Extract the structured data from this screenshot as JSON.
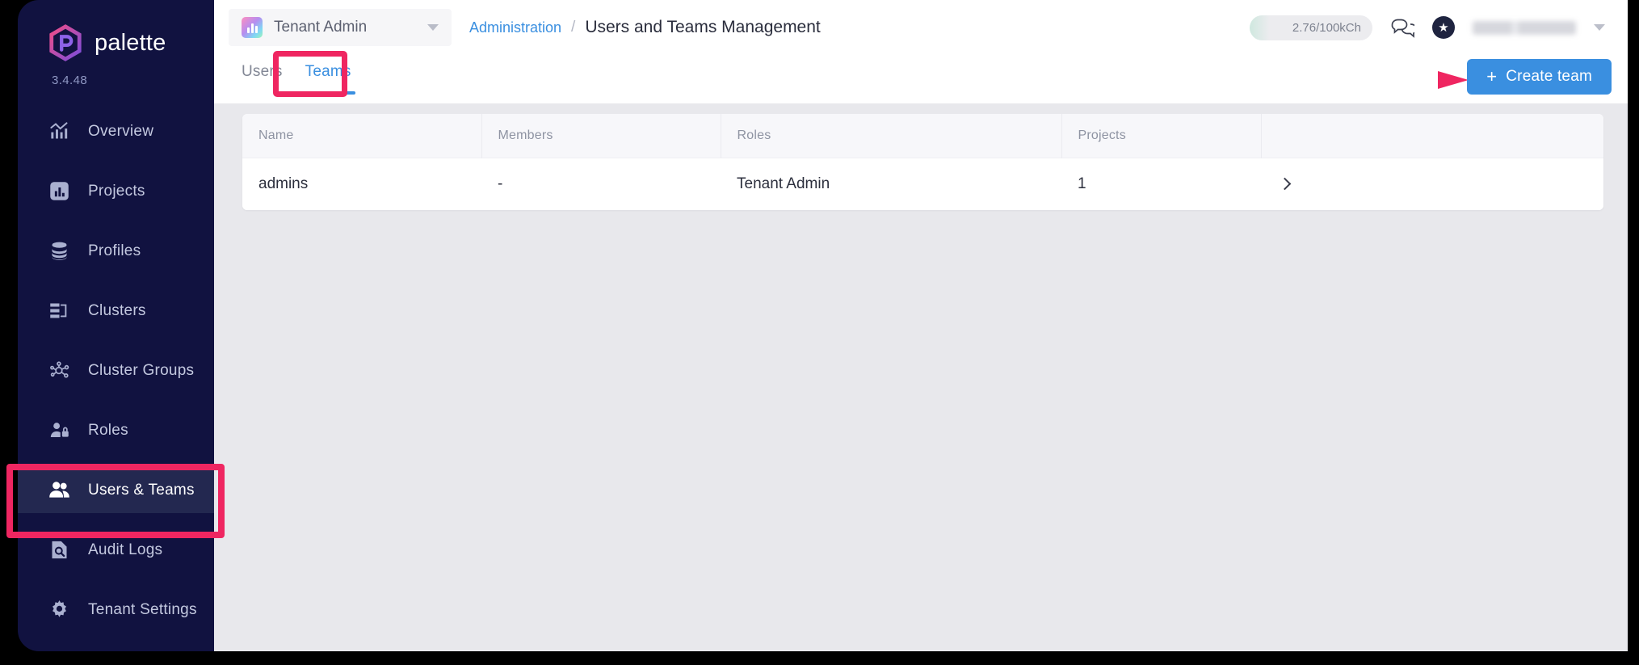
{
  "sidebar": {
    "brand": "palette",
    "version": "3.4.48",
    "items": [
      {
        "label": "Overview",
        "icon": "chart-overview-icon",
        "active": false
      },
      {
        "label": "Projects",
        "icon": "projects-icon",
        "active": false
      },
      {
        "label": "Profiles",
        "icon": "profiles-stack-icon",
        "active": false
      },
      {
        "label": "Clusters",
        "icon": "clusters-icon",
        "active": false
      },
      {
        "label": "Cluster Groups",
        "icon": "cluster-groups-icon",
        "active": false
      },
      {
        "label": "Roles",
        "icon": "roles-user-lock-icon",
        "active": false
      },
      {
        "label": "Users & Teams",
        "icon": "users-teams-icon",
        "active": true
      },
      {
        "label": "Audit Logs",
        "icon": "audit-logs-icon",
        "active": false
      },
      {
        "label": "Tenant Settings",
        "icon": "gear-icon",
        "active": false
      }
    ]
  },
  "topbar": {
    "tenant_selector": "Tenant Admin",
    "breadcrumb": {
      "parent": "Administration",
      "separator": "/",
      "current": "Users and Teams Management"
    },
    "usage": "2.76/100kCh",
    "chat_icon": "chat-bubbles-icon",
    "star_icon": "star-badge-icon",
    "user_caret_icon": "chevron-down-icon"
  },
  "tabs": [
    {
      "label": "Users",
      "active": false
    },
    {
      "label": "Teams",
      "active": true
    }
  ],
  "toolbar": {
    "create_team_label": "Create team",
    "plus": "+"
  },
  "table": {
    "columns": [
      "Name",
      "Members",
      "Roles",
      "Projects",
      ""
    ],
    "rows": [
      {
        "name": "admins",
        "members": "-",
        "roles": "Tenant Admin",
        "projects": "1"
      }
    ]
  },
  "annotations": {
    "nav_highlight_target": "Users & Teams",
    "tab_highlight_target": "Teams",
    "arrow_target": "Create team",
    "color": "#ef2661"
  }
}
